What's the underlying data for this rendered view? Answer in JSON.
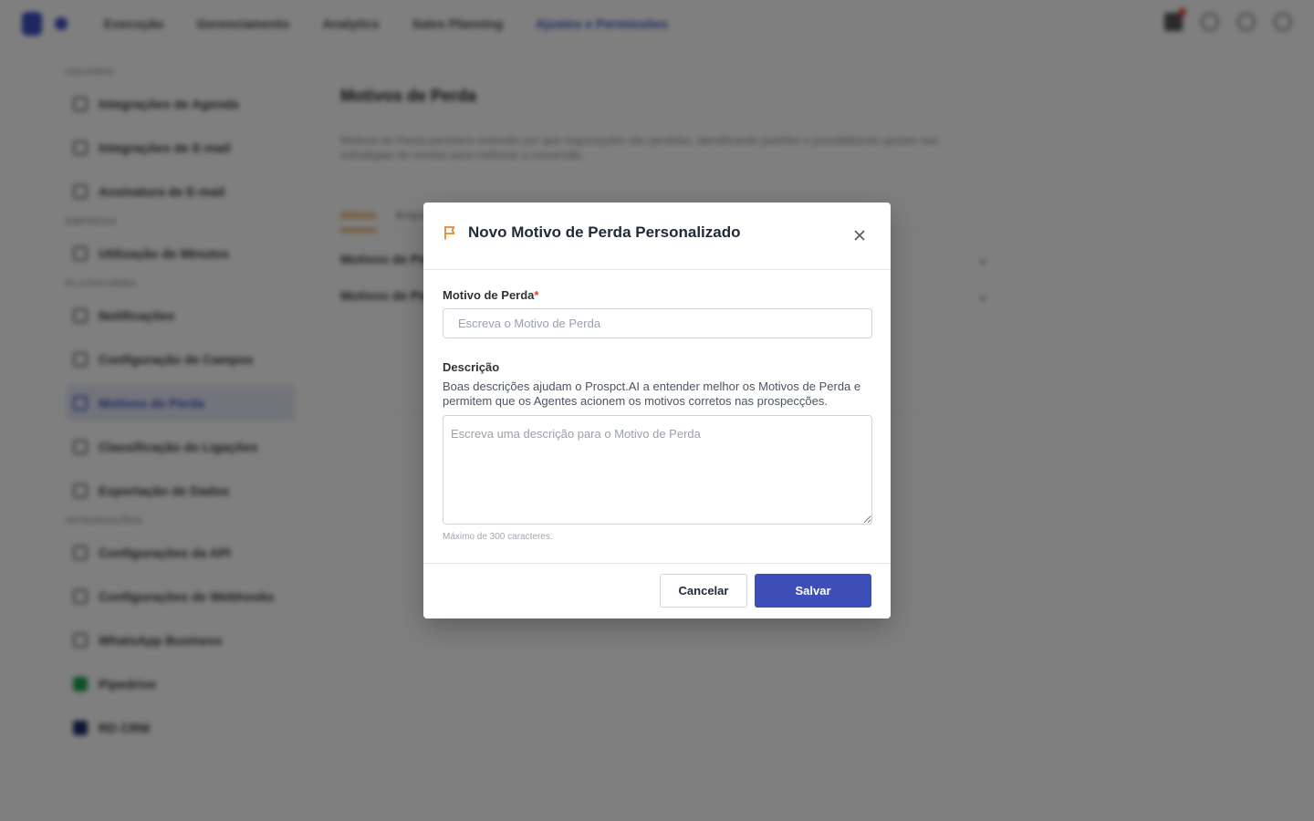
{
  "background": {
    "nav": {
      "items": [
        "Execução",
        "Gerenciamento",
        "Analytics",
        "Sales Planning"
      ],
      "active": "Ajustes e Permissões"
    },
    "sidebar": {
      "sections": [
        {
          "title": "USUÁRIO",
          "items": [
            "Integrações de Agenda",
            "Integrações de E-mail",
            "Assinatura de E-mail"
          ]
        },
        {
          "title": "EMPRESA",
          "items": [
            "Utilização de Minutos"
          ]
        },
        {
          "title": "PLATAFORMA",
          "items": [
            "Notificações",
            "Configuração de Campos",
            "Motivos de Perda",
            "Classificação de Ligações",
            "Exportação de Dados"
          ]
        },
        {
          "title": "INTEGRAÇÕES",
          "items": [
            "Configurações da API",
            "Configurações de Webhooks",
            "WhatsApp Business",
            "Pipedrive",
            "RD CRM"
          ]
        }
      ]
    },
    "content": {
      "title": "Motivos de Perda",
      "description": "Motivos de Perda permitem entender por que negociações são perdidas, identificando padrões e possibilitando ajustes nas estratégias de vendas para melhorar a conversão.",
      "tab_active": "Ativos",
      "tab_other": "Arquivados",
      "rows": [
        "Motivos de Perda Padrão",
        "Motivos de Perda Personalizados"
      ]
    }
  },
  "modal": {
    "title": "Novo Motivo de Perda Personalizado",
    "reason_label": "Motivo de Perda",
    "required_mark": "*",
    "reason_placeholder": "Escreva o Motivo de Perda",
    "description_label": "Descrição",
    "description_help": "Boas descrições ajudam o Prospct.AI a entender melhor os Motivos de Perda e permitem que os Agentes acionem os motivos corretos nas prospecções.",
    "description_placeholder": "Escreva uma descrição para o Motivo de Perda",
    "max_note": "Máximo de 300 caracteres.",
    "cancel_label": "Cancelar",
    "save_label": "Salvar"
  },
  "icons": {
    "header": "flag-icon",
    "close": "close-icon"
  },
  "colors": {
    "primary": "#3d4eb8",
    "accent": "#e8892c",
    "required": "#e53935",
    "overlay": "rgba(0,0,0,0.5)"
  }
}
